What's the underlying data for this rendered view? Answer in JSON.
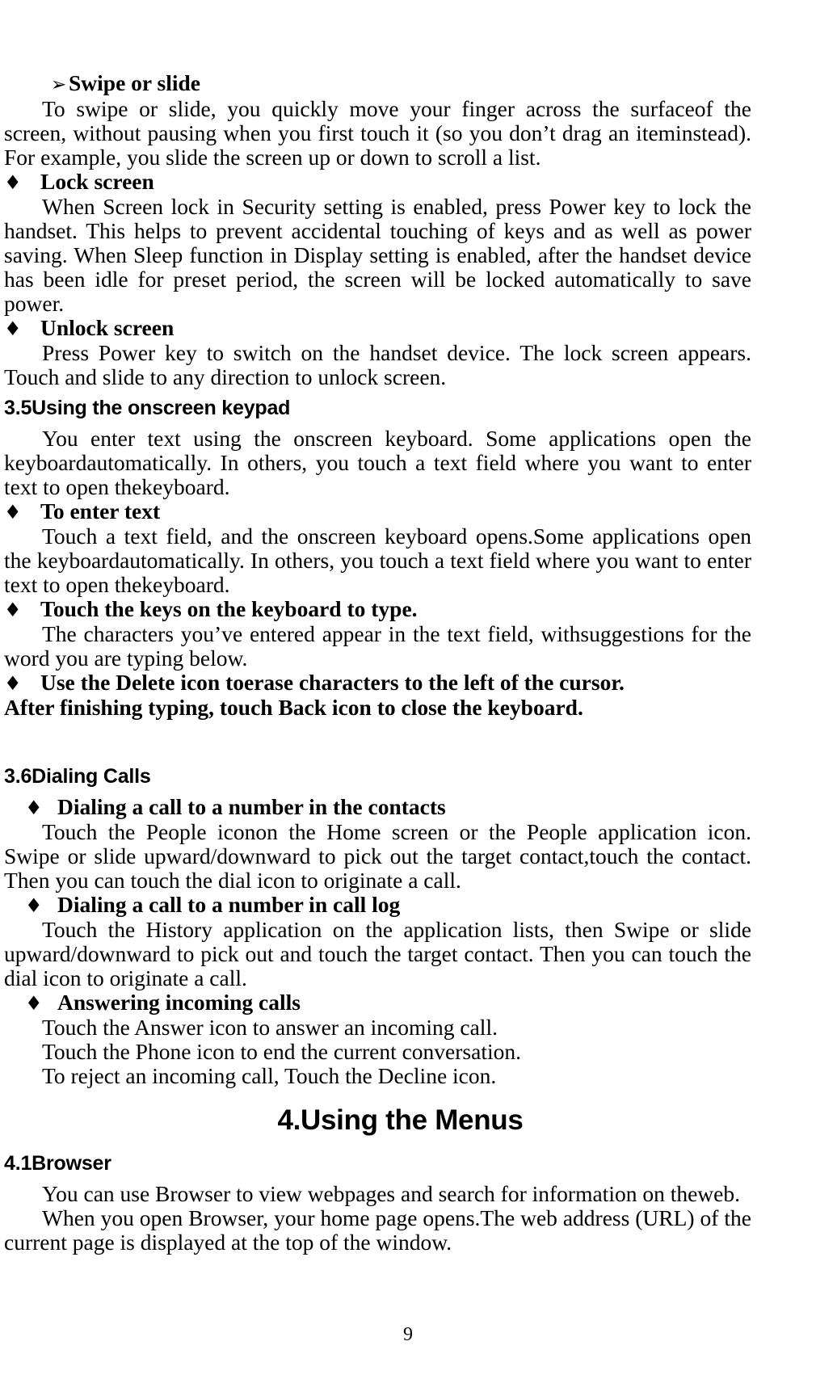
{
  "document": {
    "page_number": "9",
    "bullet_glyphs": {
      "arrow": "➢",
      "diamond": "♦"
    },
    "blocks": [
      {
        "kind": "bullet",
        "level": "arrow",
        "name": "bullet-swipe-or-slide",
        "text": "Swipe or slide"
      },
      {
        "kind": "para",
        "name": "para-swipe-or-slide",
        "text": "To swipe or slide, you quickly move your finger across the surfaceof the screen, without pausing when you first touch it (so you don’t drag an iteminstead). For example, you slide the screen up or down to scroll a list."
      },
      {
        "kind": "bullet",
        "level": "lvl0",
        "name": "bullet-lock-screen",
        "text": "Lock screen"
      },
      {
        "kind": "para",
        "name": "para-lock-screen",
        "text": "When Screen lock in Security setting is enabled, press Power key to lock the handset. This helps to prevent accidental touching of keys and as well as power saving.    When Sleep function in Display setting is enabled, after the handset device has been idle for preset period, the screen will be locked automatically to save power."
      },
      {
        "kind": "bullet",
        "level": "lvl0",
        "name": "bullet-unlock-screen",
        "text": "Unlock screen"
      },
      {
        "kind": "para",
        "name": "para-unlock-screen",
        "text": "Press Power key to switch on the handset device. The lock screen appears. Touch and slide to any direction to unlock screen."
      },
      {
        "kind": "heading-sub",
        "name": "heading-3-5-using-the-onscreen-keypad",
        "text": "3.5Using the onscreen keypad"
      },
      {
        "kind": "para",
        "name": "para-onscreen-keyboard-intro",
        "text": "You enter text using the onscreen keyboard. Some applications open the keyboardautomatically. In others, you touch a text field where you want to enter text to open thekeyboard."
      },
      {
        "kind": "bullet",
        "level": "lvl0",
        "name": "bullet-to-enter-text",
        "text": "To enter text"
      },
      {
        "kind": "para",
        "name": "para-to-enter-text",
        "text": "Touch a text field, and the onscreen keyboard opens.Some applications open the keyboardautomatically. In others, you touch a text field where you want to enter text to open thekeyboard."
      },
      {
        "kind": "bullet",
        "level": "lvl0",
        "name": "bullet-touch-the-keys",
        "text": "Touch the keys on the keyboard to type."
      },
      {
        "kind": "para",
        "name": "para-touch-the-keys",
        "text": "The characters you’ve entered appear in the text field, withsuggestions for the word you are typing below."
      },
      {
        "kind": "bullet",
        "level": "lvl0",
        "name": "bullet-use-delete-icon",
        "text": "Use the Delete icon toerase characters to the left of the cursor."
      },
      {
        "kind": "boldline",
        "name": "line-after-finishing-typing",
        "text": "After finishing typing, touch Back icon to close the keyboard."
      },
      {
        "kind": "spacer-large",
        "name": "spacer-before-dialing-calls",
        "text": ""
      },
      {
        "kind": "heading-sub",
        "name": "heading-3-6-dialing-calls",
        "text": "3.6Dialing Calls"
      },
      {
        "kind": "bullet",
        "level": "lvl1",
        "name": "bullet-dialing-call-contacts",
        "text": "Dialing a call to a number in the contacts"
      },
      {
        "kind": "para",
        "name": "para-dialing-call-contacts",
        "text": "Touch the People iconon the Home screen or the People application icon. Swipe or slide upward/downward to pick out the target contact,touch the contact. Then you can touch the dial icon to originate a call."
      },
      {
        "kind": "bullet",
        "level": "lvl1",
        "name": "bullet-dialing-call-log",
        "text": "Dialing a call to a number in call log"
      },
      {
        "kind": "para",
        "name": "para-dialing-call-log",
        "text": "Touch the History application on the application lists, then Swipe or slide upward/downward to pick out and touch the target contact. Then you can touch the dial icon to originate a call."
      },
      {
        "kind": "bullet",
        "level": "lvl1",
        "name": "bullet-answering-incoming-calls",
        "text": "Answering incoming calls"
      },
      {
        "kind": "line",
        "name": "line-touch-answer-icon",
        "text": "Touch the Answer icon to answer an incoming call."
      },
      {
        "kind": "line",
        "name": "line-touch-phone-icon",
        "text": "Touch the Phone icon to end the current conversation."
      },
      {
        "kind": "line",
        "name": "line-reject-incoming-call",
        "text": "To reject an incoming call, Touch the Decline icon."
      },
      {
        "kind": "heading-chapter",
        "name": "heading-4-using-the-menus",
        "text": "4.Using the Menus"
      },
      {
        "kind": "heading-sub",
        "name": "heading-4-1-browser",
        "text": "4.1Browser"
      },
      {
        "kind": "line",
        "name": "line-browser-view-webpages",
        "text": "You can use Browser to view webpages and search for information on theweb."
      },
      {
        "kind": "para",
        "name": "para-browser-home-page",
        "text": "When you open Browser, your home page opens.The web address (URL) of the current page is displayed at the top of the window."
      }
    ]
  }
}
